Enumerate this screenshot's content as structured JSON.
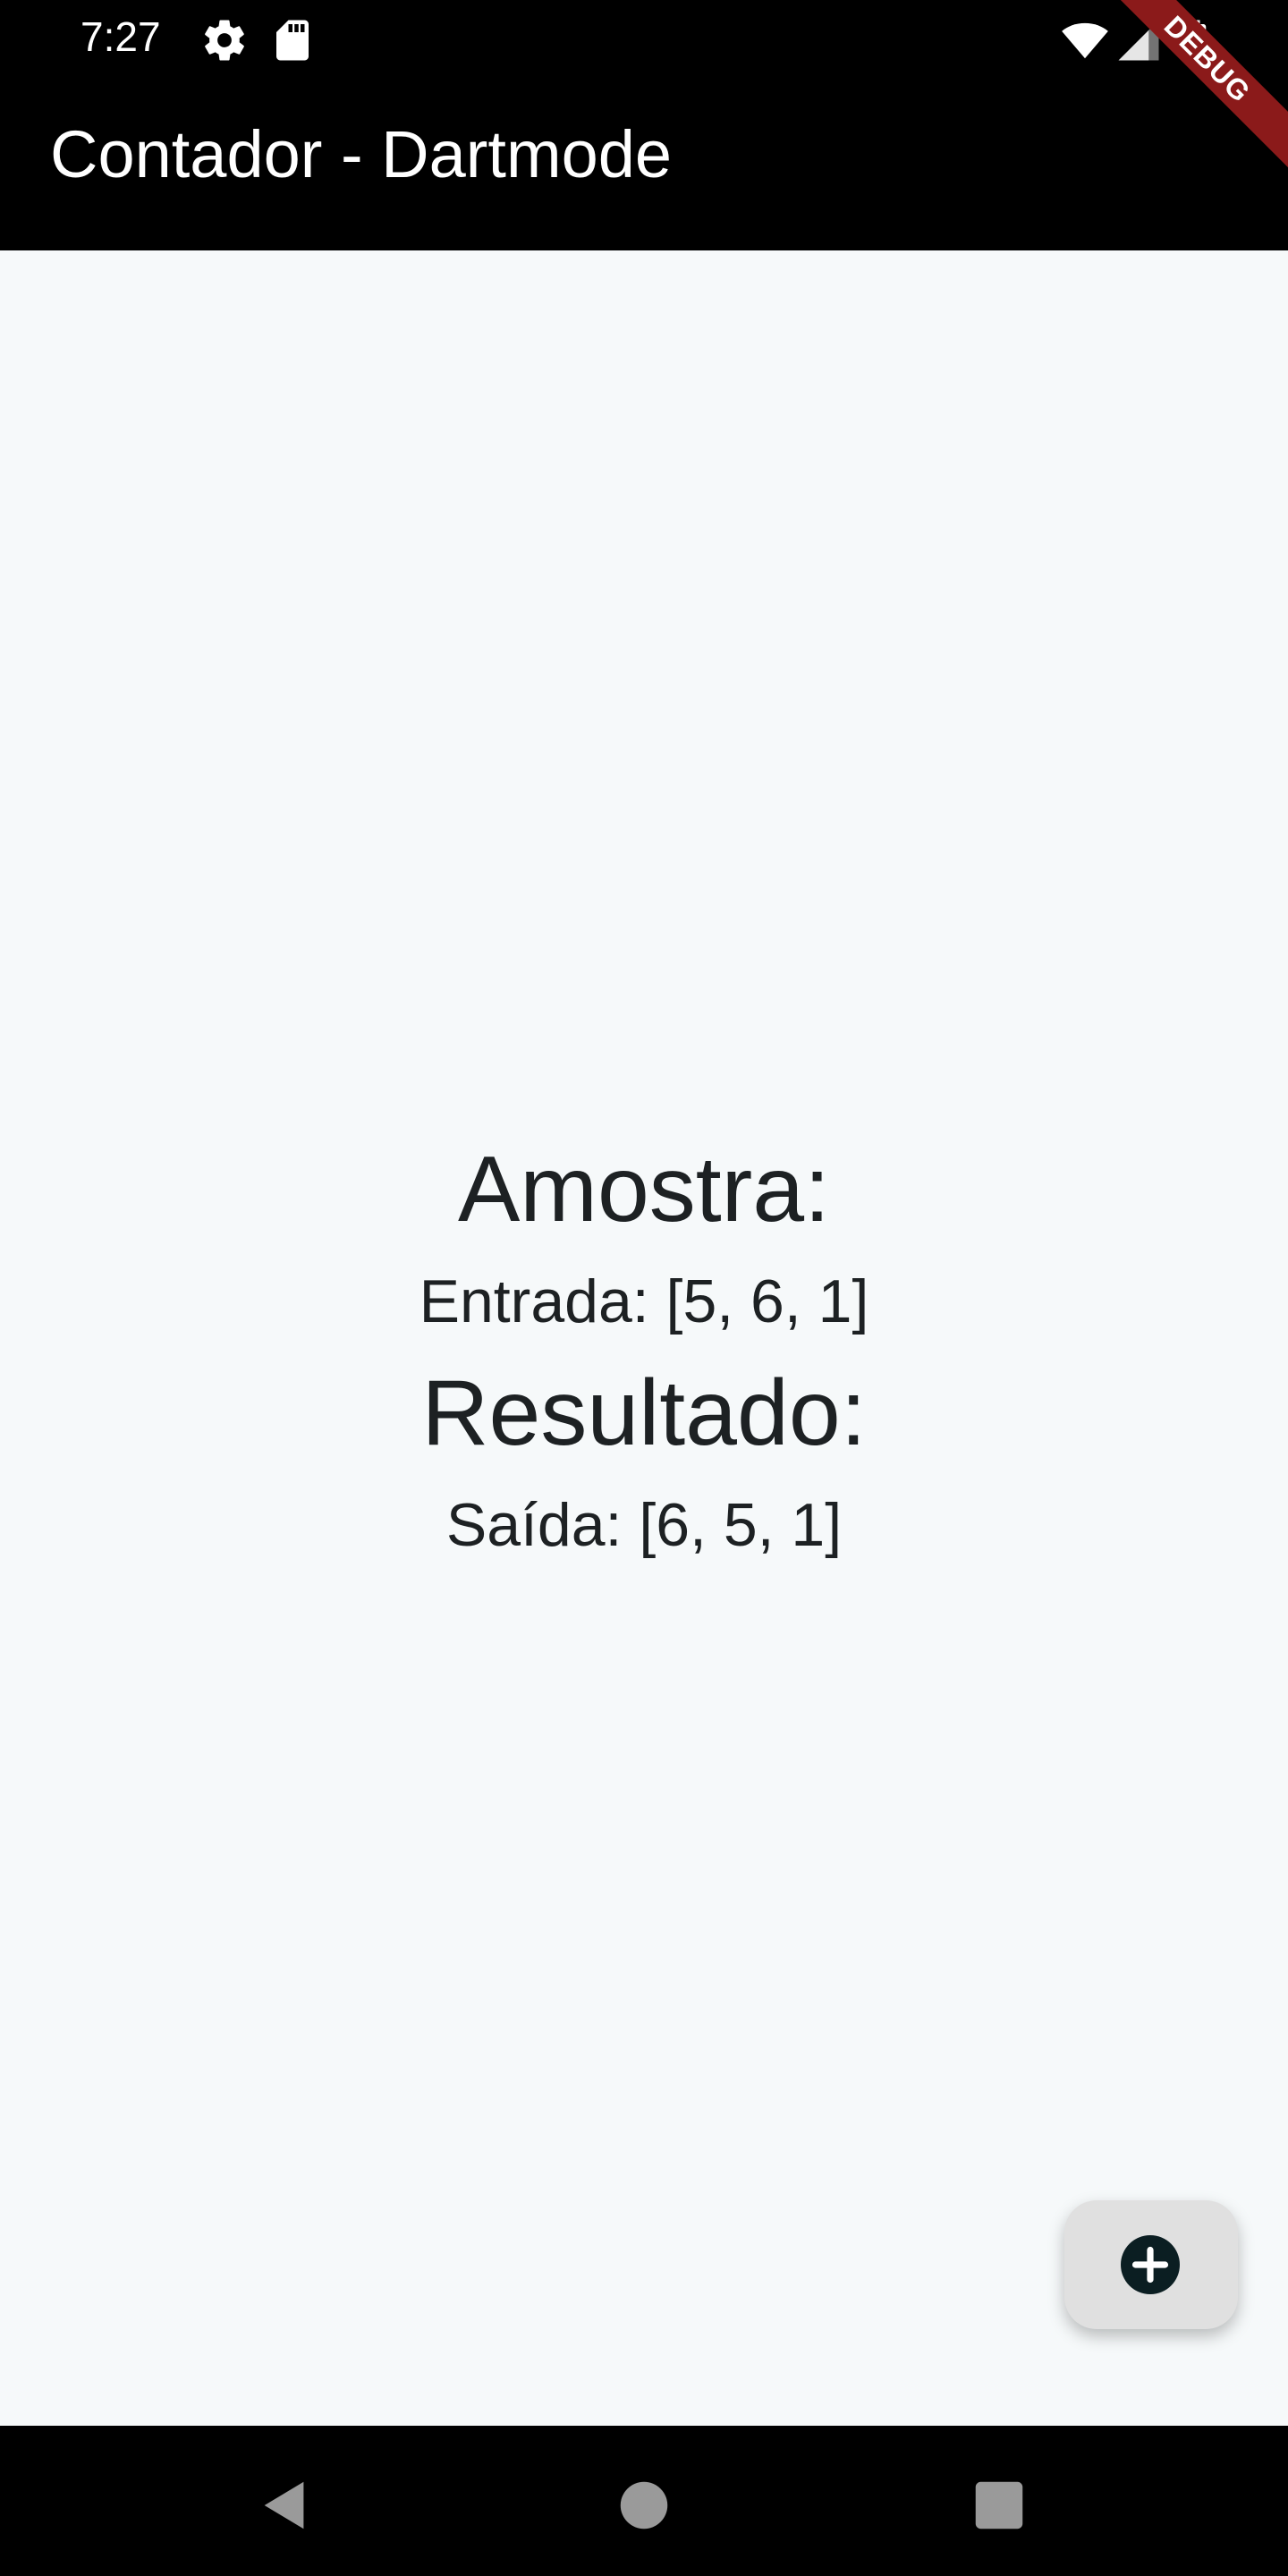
{
  "status_bar": {
    "time": "7:27",
    "left_icons": [
      "gear-icon",
      "sd-card-icon"
    ],
    "right_icons": [
      "wifi-icon",
      "cellular-signal-icon",
      "battery-icon"
    ]
  },
  "app_bar": {
    "title": "Contador - Dartmode"
  },
  "debug_banner": "DEBUG",
  "main": {
    "sample_heading": "Amostra:",
    "input_text": "Entrada: [5, 6, 1]",
    "result_heading": "Resultado:",
    "output_text": "Saída: [6, 5, 1]"
  },
  "fab": {
    "icon": "add-circle-icon"
  },
  "nav_bar": {
    "buttons": [
      "back-icon",
      "home-icon",
      "recents-icon"
    ]
  },
  "colors": {
    "app_bar": "#000000",
    "background": "#f6f9fa",
    "text": "#1d2123",
    "fab": "#e0e0e0",
    "fab_icon": "#0b1e22",
    "debug_ribbon": "#8b1a1a"
  }
}
